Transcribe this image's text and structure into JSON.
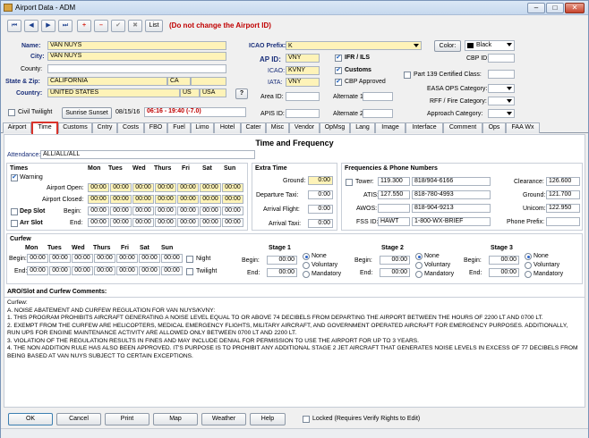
{
  "window": {
    "title": "Airport Data - ADM",
    "min": "–",
    "max": "□",
    "close": "✕"
  },
  "toolbar": {
    "first": "⏮",
    "prev": "◀",
    "next": "▶",
    "last": "⏭",
    "add": "+",
    "remove": "–",
    "confirm": "✔",
    "cancel": "✖",
    "list": "List",
    "warning": "(Do not change the Airport ID)"
  },
  "header": {
    "name_label": "Name:",
    "name": "VAN NUYS",
    "city_label": "City:",
    "city": "VAN NUYS",
    "county_label": "County:",
    "county": "",
    "statezip_label": "State & Zip:",
    "state": "CALIFORNIA",
    "state_code": "CA",
    "zip": "",
    "country_label": "Country:",
    "country": "UNITED STATES",
    "country_code": "US",
    "country_code3": "USA",
    "help": "?",
    "icao_prefix_label": "ICAO Prefix:",
    "icao_prefix": "K",
    "color_button": "Color:",
    "color_value": "Black",
    "color_swatch": "#000000",
    "apid_label": "AP ID:",
    "apid": "VNY",
    "icao_label": "ICAO:",
    "icao": "KVNY",
    "iata_label": "IATA:",
    "iata": "VNY",
    "area_label": "Area ID:",
    "area": "",
    "apis_label": "APIS ID:",
    "apis": "",
    "ifr_label": "IFR / ILS",
    "customs_label": "Customs",
    "cbp_approved_label": "CBP Approved",
    "alt1_label": "Alternate 1:",
    "alt1": "",
    "alt2_label": "Alternate 2:",
    "alt2": "",
    "cbpid_label": "CBP ID:",
    "cbpid": "",
    "p139_label": "Part 139 Certified Class:",
    "easa_label": "EASA OPS Category:",
    "rff_label": "RFF / Fire Category:",
    "approach_label": "Approach Category:",
    "civil_label": "Civil Twilight",
    "sunrise_button": "Sunrise Sunset",
    "date": "08/15/16",
    "sun_times": "06:16 - 19:40 (-7.0)"
  },
  "tabs": [
    "Airport",
    "Time",
    "Customs",
    "Cntry",
    "Costs",
    "FBO",
    "Fuel",
    "Limo",
    "Hotel",
    "Cater",
    "Misc",
    "Vendor",
    "OpMsg",
    "Lang",
    "Image",
    "Interface",
    "Comment",
    "Ops",
    "FAA Wx"
  ],
  "time": {
    "heading": "Time and Frequency",
    "attendance_label": "Attendance:",
    "attendance": "ALL/ALL/ALL",
    "times_title": "Times",
    "warning_label": "Warning",
    "days": [
      "Mon",
      "Tues",
      "Wed",
      "Thurs",
      "Fri",
      "Sat",
      "Sun"
    ],
    "open_label": "Airport Open:",
    "closed_label": "Airport Closed:",
    "dep_slot_label": "Dep Slot",
    "arr_slot_label": "Arr Slot",
    "begin_label": "Begin:",
    "end_label": "End:",
    "zero": "00:00",
    "extra_title": "Extra Time",
    "ground_label": "Ground:",
    "dep_taxi_label": "Departure Taxi:",
    "arr_flight_label": "Arrival Flight:",
    "arr_taxi_label": "Arrival Taxi:",
    "ground": "0:00",
    "dep_taxi": "0:00",
    "arr_flight": "0:00",
    "arr_taxi": "0:00",
    "freq_title": "Frequencies & Phone Numbers",
    "tower_label": "Tower:",
    "tower_freq": "119.300",
    "tower_phone": "818/904-6166",
    "atis_label": "ATIS:",
    "atis_freq": "127.550",
    "atis_phone": "818-780-4993",
    "awos_label": "AWOS:",
    "awos_freq": "",
    "awos_phone": "818-904-9213",
    "fss_label": "FSS ID:",
    "fss": "HAWT",
    "fss_phone": "1-800-WX-BRIEF",
    "clearance_label": "Clearance:",
    "clearance": "126.600",
    "ground_freq_label": "Ground:",
    "ground_freq": "121.700",
    "unicom_label": "Unicom:",
    "unicom": "122.950",
    "phone_prefix_label": "Phone Prefix:",
    "phone_prefix": "",
    "curfew_title": "Curfew",
    "night_label": "Night",
    "twilight_label": "Twilight",
    "stage1": "Stage 1",
    "stage2": "Stage 2",
    "stage3": "Stage 3",
    "none": "None",
    "voluntary": "Voluntary",
    "mandatory": "Mandatory",
    "comments_title": "ARO/Slot and Curfew Comments:",
    "comments": [
      "Curfew:",
      "A. NOISE ABATEMENT AND CURFEW REGULATION FOR VAN NUYS/KVNY:",
      "1. THIS PROGRAM PROHIBITS AIRCRAFT GENERATING A NOISE LEVEL EQUAL TO OR ABOVE 74 DECIBELS FROM DEPARTING THE AIRPORT BETWEEN THE HOURS OF 2200 LT AND 0700 LT.",
      "2. EXEMPT FROM THE CURFEW ARE HELICOPTERS, MEDICAL EMERGENCY FLIGHTS, MILITARY AIRCRAFT, AND GOVERNMENT OPERATED AIRCRAFT FOR EMERGENCY PURPOSES. ADDITIONALLY, RUN UPS FOR ENGINE MAINTENANCE ACTIVITY ARE ALLOWED ONLY BETWEEN 0700 LT AND 2200 LT.",
      "3. VIOLATION OF THE REGULATION RESULTS IN FINES AND MAY INCLUDE DENIAL FOR PERMISSION TO USE THE AIRPORT FOR UP TO 3 YEARS.",
      "4. THE NON ADDITION RULE HAS ALSO BEEN APPROVED. IT'S PURPOSE IS TO PROHIBIT ANY ADDITIONAL STAGE 2 JET AIRCRAFT THAT GENERATES NOISE LEVELS IN EXCESS OF 77 DECIBELS FROM BEING BASED AT VAN NUYS SUBJECT TO CERTAIN EXCEPTIONS."
    ]
  },
  "footer": {
    "ok": "OK",
    "cancel": "Cancel",
    "print": "Print",
    "map": "Map",
    "weather": "Weather",
    "help": "Help",
    "locked_label": "Locked (Requires Verify Rights to Edit)"
  }
}
